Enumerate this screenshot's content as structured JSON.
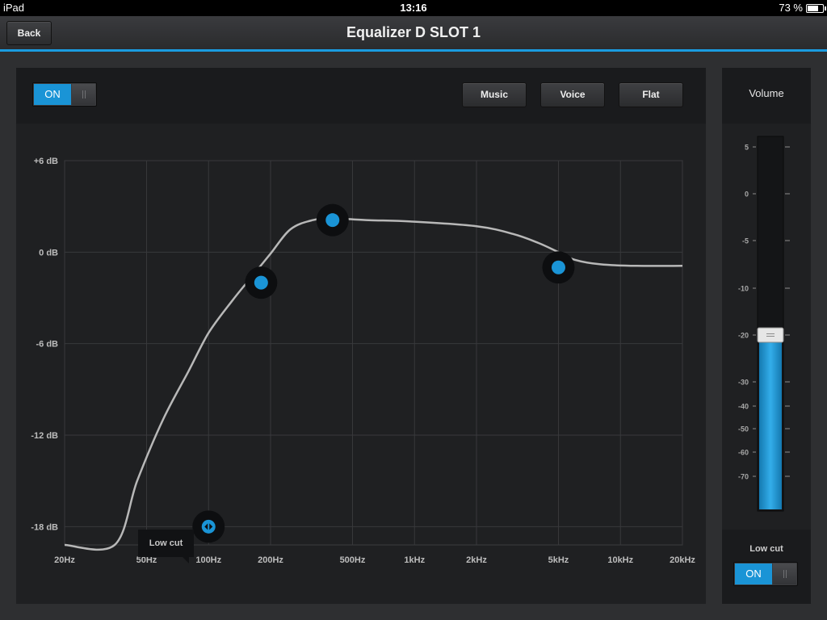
{
  "status_bar": {
    "device": "iPad",
    "time": "13:16",
    "battery": "73 %",
    "battery_level": 0.73
  },
  "nav": {
    "back_label": "Back",
    "title": "Equalizer D SLOT 1"
  },
  "eq": {
    "power_toggle": "ON",
    "presets": [
      "Music",
      "Voice",
      "Flat"
    ],
    "tooltip": "Low cut",
    "accent_color": "#1a94d6"
  },
  "chart_data": {
    "type": "line",
    "x_scale": "log",
    "x_ticks": [
      {
        "value": 20,
        "label": "20Hz"
      },
      {
        "value": 50,
        "label": "50Hz"
      },
      {
        "value": 100,
        "label": "100Hz"
      },
      {
        "value": 200,
        "label": "200Hz"
      },
      {
        "value": 500,
        "label": "500Hz"
      },
      {
        "value": 1000,
        "label": "1kHz"
      },
      {
        "value": 2000,
        "label": "2kHz"
      },
      {
        "value": 5000,
        "label": "5kHz"
      },
      {
        "value": 10000,
        "label": "10kHz"
      },
      {
        "value": 20000,
        "label": "20kHz"
      }
    ],
    "y_ticks": [
      {
        "value": 6,
        "label": "+6 dB"
      },
      {
        "value": 0,
        "label": "0 dB"
      },
      {
        "value": -6,
        "label": "-6 dB"
      },
      {
        "value": -12,
        "label": "-12 dB"
      },
      {
        "value": -18,
        "label": "-18 dB"
      }
    ],
    "xlim": [
      20,
      20000
    ],
    "ylim": [
      -19.2,
      6.0
    ],
    "grid": true,
    "curve": [
      [
        20,
        -19.2
      ],
      [
        35,
        -19.2
      ],
      [
        45,
        -15.0
      ],
      [
        60,
        -11.0
      ],
      [
        80,
        -7.8
      ],
      [
        100,
        -5.3
      ],
      [
        130,
        -3.2
      ],
      [
        160,
        -1.7
      ],
      [
        200,
        -0.1
      ],
      [
        250,
        1.5
      ],
      [
        320,
        2.1
      ],
      [
        400,
        2.2
      ],
      [
        600,
        2.1
      ],
      [
        1000,
        2.0
      ],
      [
        2000,
        1.7
      ],
      [
        3000,
        1.2
      ],
      [
        4000,
        0.6
      ],
      [
        5000,
        0.0
      ],
      [
        6000,
        -0.5
      ],
      [
        8000,
        -0.8
      ],
      [
        12000,
        -0.9
      ],
      [
        20000,
        -0.9
      ]
    ],
    "points": [
      {
        "name": "low-cut",
        "freq": 100,
        "gain": -18.0
      },
      {
        "name": "band-1",
        "freq": 180,
        "gain": -2.0
      },
      {
        "name": "band-2",
        "freq": 400,
        "gain": 2.1
      },
      {
        "name": "band-3",
        "freq": 5000,
        "gain": -1.0
      }
    ]
  },
  "volume": {
    "title": "Volume",
    "ticks": [
      "5",
      "0",
      "-5",
      "-10",
      "-20",
      "-30",
      "-40",
      "-50",
      "-60",
      "-70"
    ],
    "tick_values": [
      5,
      0,
      -5,
      -10,
      -20,
      -30,
      -40,
      -50,
      -60,
      -70
    ],
    "value": -20,
    "low_cut_label": "Low cut",
    "low_cut_toggle": "ON"
  }
}
